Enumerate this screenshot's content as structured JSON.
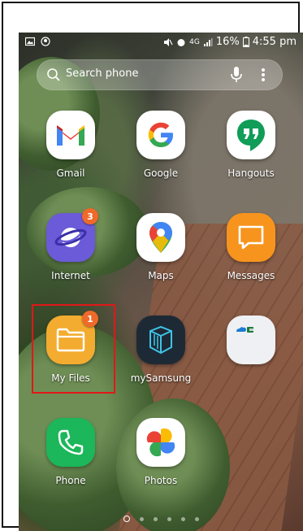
{
  "status": {
    "time": "4:55 pm",
    "battery": "16%",
    "network": "4G"
  },
  "search": {
    "placeholder": "Search phone"
  },
  "apps": [
    {
      "label": "Gmail"
    },
    {
      "label": "Google"
    },
    {
      "label": "Hangouts"
    },
    {
      "label": "Internet",
      "badge": "3"
    },
    {
      "label": "Maps"
    },
    {
      "label": "Messages"
    },
    {
      "label": "My Files",
      "badge": "1"
    },
    {
      "label": "mySamsung"
    },
    {
      "label": "Phone"
    },
    {
      "label": "Photos"
    }
  ],
  "page_indicator": {
    "pages": 6,
    "active": 1
  },
  "colors": {
    "highlight": "#e01818",
    "badge": "#ef6a2a",
    "hangouts": "#0f9d58",
    "messages": "#f7941d",
    "myfiles": "#f3ac2f",
    "phone": "#1bb75a",
    "internet": "#6b5bd8"
  },
  "icons": {
    "status_left": [
      "gallery-icon",
      "privacy-icon"
    ],
    "status_right": [
      "mute-icon",
      "alarm-icon",
      "signal-icon",
      "battery-icon"
    ],
    "search": "search-icon",
    "mic": "microphone-icon",
    "more": "more-vertical-icon"
  }
}
